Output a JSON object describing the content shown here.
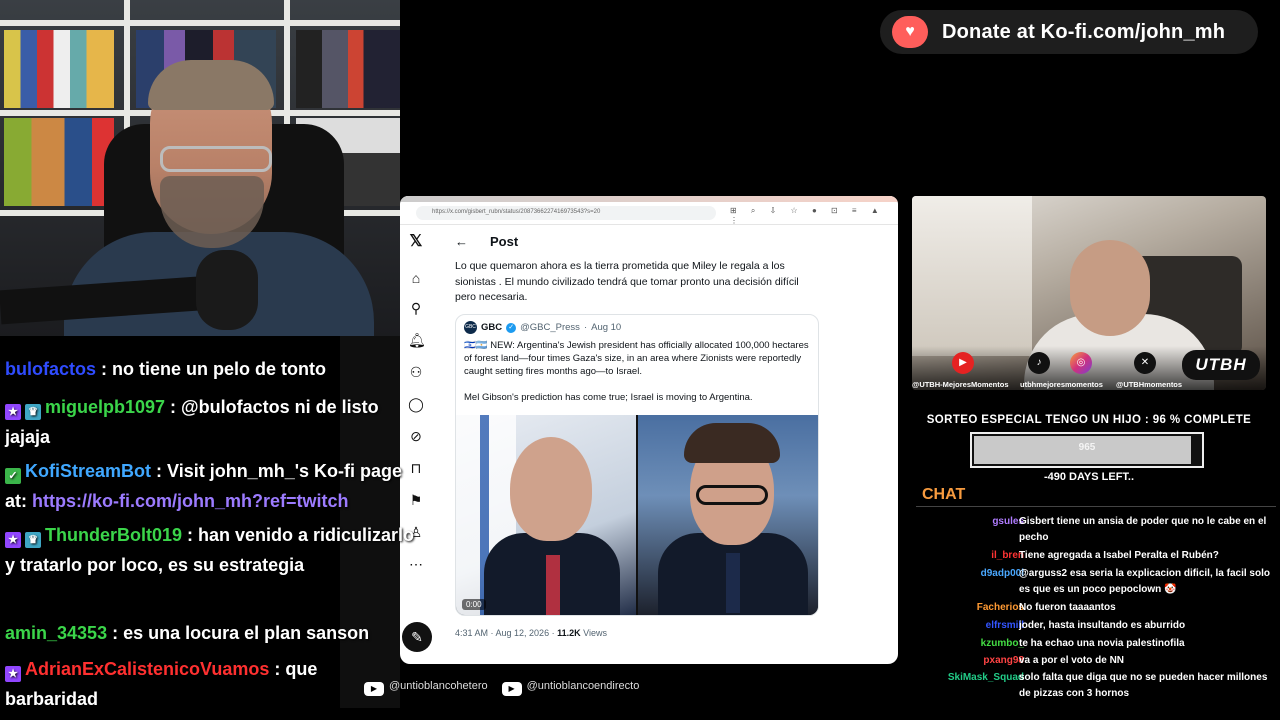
{
  "kofi_banner": {
    "icon": "kofi-cup-icon",
    "text": "Donate at Ko-fi.com/john_mh"
  },
  "browser": {
    "url": "https://x.com/gisbert_rubn/status/2087366227416973543?s=20",
    "post_header": "Post",
    "post_text": "Lo que quemaron ahora es la tierra prometida que Miley le regala a los sionistas . El mundo civilizado tendrá que tomar pronto una decisión difícil pero necesaria.",
    "quote": {
      "logo": "GBC",
      "name": "GBC",
      "handle": "@GBC_Press",
      "date": "Aug 10",
      "body": "🇮🇱🇦🇷 NEW: Argentina's Jewish president has officially allocated 100,000 hectares of forest land—four times Gaza's size, in an area where Zionists were reportedly caught setting fires months ago—to Israel.",
      "body2": "Mel Gibson's prediction has come true; Israel is moving to Argentina.",
      "video_time": "0:00"
    },
    "meta_time": "4:31 AM · Aug 12, 2026 · ",
    "meta_views": "11.2K",
    "meta_views_label": " Views"
  },
  "left_chat": [
    {
      "user": "bulofactos",
      "color": "#2f4cff",
      "text": ": no tiene un pelo de tonto",
      "badges": []
    },
    {
      "user": "miguelpb1097",
      "color": "#3bd54a",
      "text": ": @bulofactos ni de listo jajaja",
      "badges": [
        "b-purple",
        "b-teal"
      ]
    },
    {
      "user": "KofiStreamBot",
      "color": "#40a8ff",
      "text": ": Visit john_mh_'s Ko-fi page at: ",
      "link": "https://ko-fi.com/john_mh?ref=twitch",
      "badges": [
        "b-green"
      ]
    },
    {
      "user": "ThunderBolt019",
      "color": "#3bd54a",
      "text": ": han venido a ridiculizarlo y tratarlo por loco, es su estrategia",
      "badges": [
        "b-purple",
        "b-teal"
      ]
    },
    {
      "user": "amin_34353",
      "color": "#3bd54a",
      "text": ": es una locura el plan sanson",
      "badges": []
    },
    {
      "user": "AdrianExCalistenicoVuamos",
      "color": "#ff3030",
      "text": ": que barbaridad",
      "badges": [
        "b-purple"
      ]
    }
  ],
  "socials": {
    "yt1": "@untioblancohetero",
    "yt2": "@untioblancoendirecto"
  },
  "right_cam": {
    "labels": [
      "@UTBH-MejoresMomentos",
      "utbhmejoresmomentos",
      "@UTBHmomentos"
    ],
    "logo": "UTBH"
  },
  "goal": {
    "title": "SORTEO ESPECIAL TENGO UN HIJO :  96 % COMPLETE",
    "value": "965",
    "percent": 96,
    "days": "-490 DAYS LEFT.."
  },
  "right_chat": {
    "header": "CHAT",
    "messages": [
      {
        "user": "gsules",
        "color": "#b07cff",
        "text": "Gisbert tiene un ansia de poder que no le cabe en el pecho"
      },
      {
        "user": "il_bren",
        "color": "#ff3333",
        "text": "Tiene agregada a Isabel Peralta el Rubén?"
      },
      {
        "user": "d9adp00l",
        "color": "#4aa8ff",
        "text": "@arguss2 esa seria la explicacion dificil, la facil solo es que es un poco pepoclown 🤡"
      },
      {
        "user": "Facherios",
        "color": "#ff9a33",
        "text": "No fueron taaaantos"
      },
      {
        "user": "elfrsmill",
        "color": "#3355ff",
        "text": "joder, hasta insultando es aburrido"
      },
      {
        "user": "kzumbo_",
        "color": "#44dd44",
        "text": "te ha echao una novia palestinofila"
      },
      {
        "user": "pxang98",
        "color": "#ff4444",
        "text": "va a por el voto de NN"
      },
      {
        "user": "SkiMask_Squad",
        "color": "#22cc88",
        "text": "solo falta que diga que no se pueden hacer millones de pizzas con 3 hornos"
      }
    ]
  }
}
